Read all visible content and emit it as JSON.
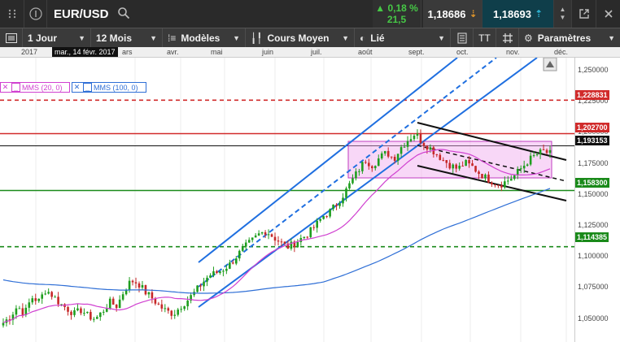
{
  "topbar": {
    "symbol": "EUR/USD",
    "change_pct": "0,18 %",
    "change_points": "21,5",
    "sell_price": "1,18686",
    "buy_price": "1,18693",
    "change_direction": "up",
    "colors": {
      "up": "#46c846",
      "sell_arrow": "#e0952a",
      "buy_arrow": "#2fb9d9"
    }
  },
  "toolbar": {
    "period": "1 Jour",
    "range": "12 Mois",
    "models": "Modèles",
    "price_type": "Cours Moyen",
    "link": "Lié",
    "settings": "Paramètres",
    "text_tool": "TT"
  },
  "month_axis": {
    "date_tag": "mar., 14 févr. 2017",
    "labels": [
      "2017",
      "ars",
      "avr.",
      "mai",
      "juin",
      "juil.",
      "août",
      "sept.",
      "oct.",
      "nov.",
      "déc."
    ]
  },
  "legends": [
    {
      "label": "MMS (20, 0)",
      "color": "#d040d0"
    },
    {
      "label": "MMS (100, 0)",
      "color": "#2f6fd6"
    }
  ],
  "price_axis": {
    "ticks": [
      "1,250000",
      "1,225000",
      "1,200000",
      "1,175000",
      "1,150000",
      "1,125000",
      "1,100000",
      "1,075000",
      "1,050000"
    ],
    "tags": [
      {
        "value": "1,228831",
        "color": "#d12b2b"
      },
      {
        "value": "1,202700",
        "color": "#d12b2b"
      },
      {
        "value": "1,193153",
        "color": "#111111"
      },
      {
        "value": "1,158300",
        "color": "#1a8a1a"
      },
      {
        "value": "1,114385",
        "color": "#1a8a1a"
      }
    ]
  },
  "chart_data": {
    "type": "candlestick",
    "symbol": "EUR/USD",
    "timeframe": "1 Jour",
    "ylim": [
      1.04,
      1.262
    ],
    "horizontal_levels": [
      {
        "value": 1.228831,
        "color": "#d12b2b",
        "style": "dashed"
      },
      {
        "value": 1.2027,
        "color": "#d12b2b",
        "style": "solid"
      },
      {
        "value": 1.193153,
        "color": "#111111",
        "style": "solid"
      },
      {
        "value": 1.1583,
        "color": "#1a8a1a",
        "style": "solid"
      },
      {
        "value": 1.114385,
        "color": "#1a8a1a",
        "style": "dashed"
      }
    ],
    "price_path": [
      1.055,
      1.06,
      1.068,
      1.062,
      1.075,
      1.072,
      1.081,
      1.076,
      1.07,
      1.066,
      1.062,
      1.065,
      1.06,
      1.058,
      1.064,
      1.071,
      1.068,
      1.08,
      1.088,
      1.086,
      1.079,
      1.074,
      1.068,
      1.064,
      1.062,
      1.068,
      1.073,
      1.079,
      1.086,
      1.092,
      1.094,
      1.097,
      1.101,
      1.108,
      1.114,
      1.119,
      1.124,
      1.127,
      1.122,
      1.118,
      1.114,
      1.117,
      1.121,
      1.125,
      1.131,
      1.138,
      1.142,
      1.148,
      1.156,
      1.165,
      1.174,
      1.182,
      1.178,
      1.184,
      1.188,
      1.183,
      1.192,
      1.198,
      1.203,
      1.196,
      1.192,
      1.187,
      1.182,
      1.178,
      1.175,
      1.18,
      1.177,
      1.172,
      1.168,
      1.165,
      1.163,
      1.166,
      1.17,
      1.176,
      1.182,
      1.186,
      1.189,
      1.187
    ]
  }
}
